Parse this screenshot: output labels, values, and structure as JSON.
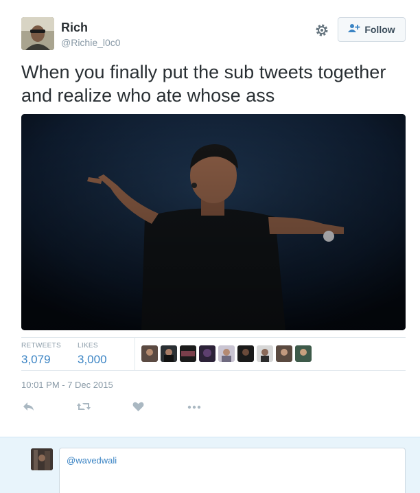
{
  "tweet": {
    "author_name": "Rich",
    "author_handle": "@Richie_l0c0",
    "follow_label": "Follow",
    "text": "When you finally put the sub tweets together and realize who ate whose ass",
    "retweets_label": "RETWEETS",
    "retweets_count": "3,079",
    "likes_label": "LIKES",
    "likes_count": "3,000",
    "timestamp": "10:01 PM - 7 Dec 2015"
  },
  "reply": {
    "input_text": "@wavedwali"
  },
  "colors": {
    "accent": "#3b84c4",
    "muted": "#8899a6",
    "reply_bg": "#e8f4fb"
  }
}
